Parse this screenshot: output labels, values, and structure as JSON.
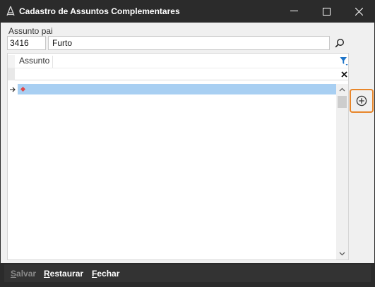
{
  "window": {
    "title": "Cadastro de Assuntos Complementares"
  },
  "parent": {
    "label": "Assunto pai",
    "code": "3416",
    "name": "Furto"
  },
  "grid": {
    "columns": [
      "Assunto"
    ],
    "rows": [
      {
        "assunto": ""
      }
    ]
  },
  "footer": {
    "salvar_hotkey": "S",
    "salvar_rest": "alvar",
    "restaurar_hotkey": "R",
    "restaurar_rest": "estaurar",
    "fechar_hotkey": "F",
    "fechar_rest": "echar"
  },
  "colors": {
    "titlebar": "#2b2b2b",
    "selected_row": "#a8cff2",
    "add_button_border": "#e8862a",
    "filter_icon": "#1e74c8",
    "new_row_marker": "#e04848"
  },
  "icons": {
    "app": "app-logo-icon",
    "search": "search-icon",
    "filter": "filter-icon",
    "clear": "clear-filter-icon",
    "row": "current-row-arrow-icon",
    "add": "add-circle-icon"
  }
}
